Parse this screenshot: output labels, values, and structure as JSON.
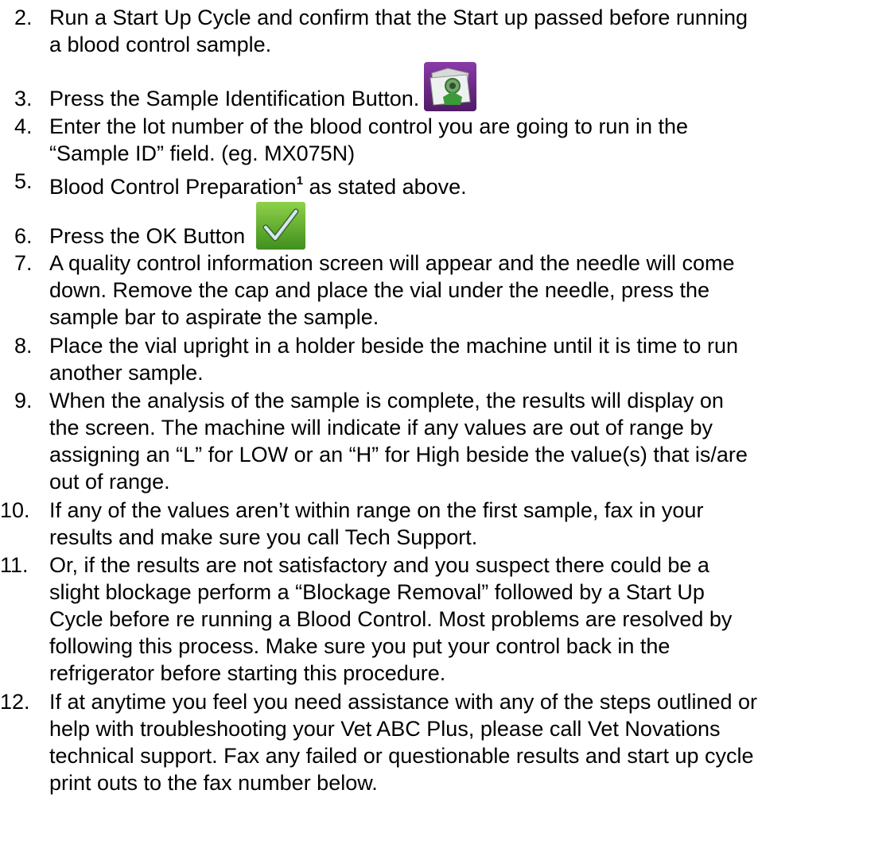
{
  "items": [
    {
      "num": "2.",
      "lines": [
        "Run a Start Up Cycle and confirm that the Start up passed before running",
        "a blood control sample."
      ]
    },
    {
      "num": "3.",
      "lines": [
        "Press the Sample Identification Button."
      ]
    },
    {
      "num": "4.",
      "lines": [
        "Enter the lot number of the blood control you are going to run in the",
        "“Sample ID” field. (eg. MX075N)"
      ]
    },
    {
      "num": "5.",
      "text_before": "Blood Control Preparation",
      "footnote": "1",
      "text_after": " as stated above."
    },
    {
      "num": "6.",
      "lines": [
        "Press the OK Button"
      ]
    },
    {
      "num": "7.",
      "lines": [
        "A quality control information screen will appear and the needle will come",
        "down. Remove the cap and place the vial under the needle, press the",
        "sample bar to aspirate the sample."
      ]
    },
    {
      "num": "8.",
      "lines": [
        "Place the vial upright in a holder beside the machine until it is time to run",
        "another sample."
      ]
    },
    {
      "num": "9.",
      "lines": [
        "When the analysis of the sample is complete, the results will display on",
        "the screen. The machine will indicate if any values are out of range by",
        "assigning an “L” for LOW or an “H” for High beside the value(s) that is/are",
        "out of range."
      ]
    },
    {
      "num": "10.",
      "lines": [
        "If any of the values aren’t within range on the first sample, fax in your",
        "results and make sure you call Tech Support."
      ]
    },
    {
      "num": "11.",
      "lines": [
        "Or, if the results are not satisfactory and you suspect there could be a",
        "slight blockage perform a “Blockage Removal” followed by a Start Up",
        "Cycle before re running a Blood Control. Most problems are resolved by",
        "following this process. Make sure you put your control back in the",
        "refrigerator before starting this procedure."
      ]
    },
    {
      "num": "12.",
      "lines": [
        "If at anytime you feel you need assistance with any of the steps outlined or",
        "help with troubleshooting your Vet ABC Plus, please call Vet Novations",
        "technical support. Fax any failed or questionable results and start up cycle",
        "print outs to the fax number below."
      ]
    }
  ],
  "icons": {
    "sample_id": "sample-identification-icon",
    "ok": "ok-checkmark-icon"
  },
  "colors": {
    "sample_id_bg": "#6b2a86",
    "ok_bg": "#5aa52c"
  }
}
